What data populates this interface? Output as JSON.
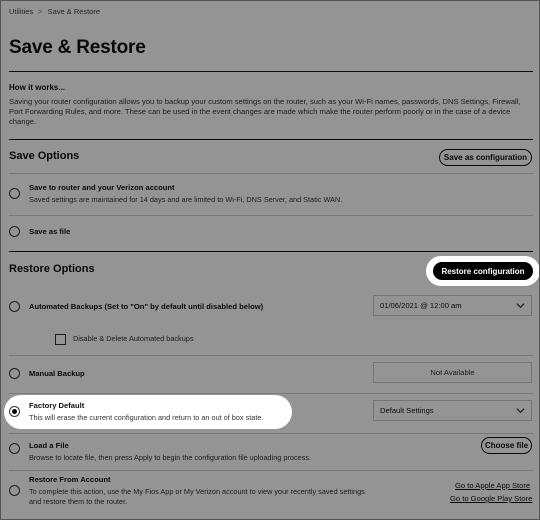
{
  "breadcrumb": {
    "parent": "Utilities",
    "separator": ">",
    "current": "Save & Restore"
  },
  "page_title": "Save & Restore",
  "how_it_works": {
    "title": "How it works...",
    "text": "Saving your router configuration allows you to backup your custom settings on the router, such as your Wi-Fi names, passwords, DNS Settings, Firewall, Port Forwarding Rules, and more. These can be used in the event changes are made which make the router perform poorly or in the case of a device change."
  },
  "save_options": {
    "title": "Save Options",
    "button": "Save as configuration",
    "option1_label": "Save to router and your Verizon account",
    "option1_desc": "Saved settings are maintained for 14 days and are limited to Wi-Fi, DNS Server, and Static WAN.",
    "option2_label": "Save as file"
  },
  "restore_options": {
    "title": "Restore Options",
    "button": "Restore configuration",
    "automated_label": "Automated Backups (Set to \"On\" by default until disabled below)",
    "automated_select": "01/06/2021 @ 12:00 am",
    "disable_checkbox_label": "Disable & Delete Automated backups",
    "manual_label": "Manual Backup",
    "manual_value": "Not Available",
    "factory_label": "Factory Default",
    "factory_desc": "This will erase the current configuration and return to an out of box state.",
    "factory_select": "Default Settings",
    "load_label": "Load a File",
    "load_desc": "Browse to locate file, then press Apply to begin the configuration file uploading process.",
    "load_button": "Choose file",
    "account_label": "Restore From Account",
    "account_desc_line1": "To complete this action, use the My Fios App or My Verizon account to view your recently saved settings",
    "account_desc_line2": "and restore them to the router.",
    "apple_link": "Go to Apple App Store",
    "google_link": "Go to Google Play Store"
  },
  "selected_restore_option": "factory_default"
}
